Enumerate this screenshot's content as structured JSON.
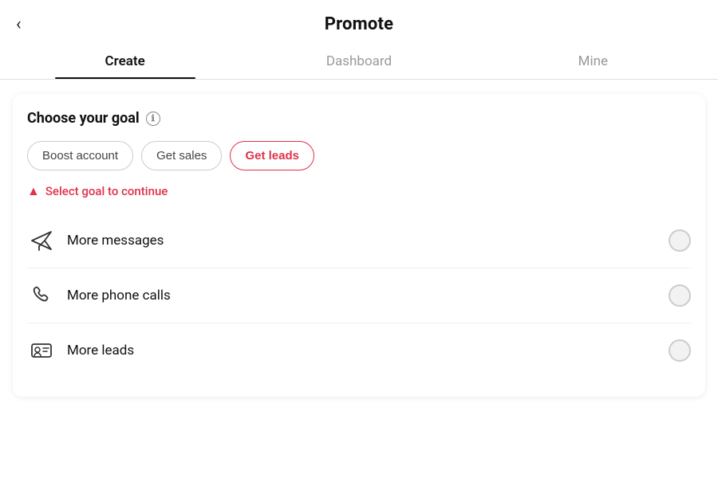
{
  "header": {
    "title": "Promote",
    "back_label": "‹"
  },
  "tabs": [
    {
      "id": "create",
      "label": "Create",
      "active": true
    },
    {
      "id": "dashboard",
      "label": "Dashboard",
      "active": false
    },
    {
      "id": "mine",
      "label": "Mine",
      "active": false
    }
  ],
  "card": {
    "goal_section": {
      "title": "Choose your goal",
      "info_icon": "ℹ",
      "buttons": [
        {
          "id": "boost",
          "label": "Boost account",
          "selected": false
        },
        {
          "id": "sales",
          "label": "Get sales",
          "selected": false
        },
        {
          "id": "leads",
          "label": "Get leads",
          "selected": true
        }
      ],
      "warning_text": "Select goal to continue"
    },
    "options": [
      {
        "id": "messages",
        "label": "More messages",
        "icon": "message"
      },
      {
        "id": "calls",
        "label": "More phone calls",
        "icon": "phone"
      },
      {
        "id": "leads",
        "label": "More leads",
        "icon": "leads"
      }
    ]
  },
  "colors": {
    "accent": "#e0324b",
    "active_tab_underline": "#111111",
    "border": "#cccccc"
  }
}
